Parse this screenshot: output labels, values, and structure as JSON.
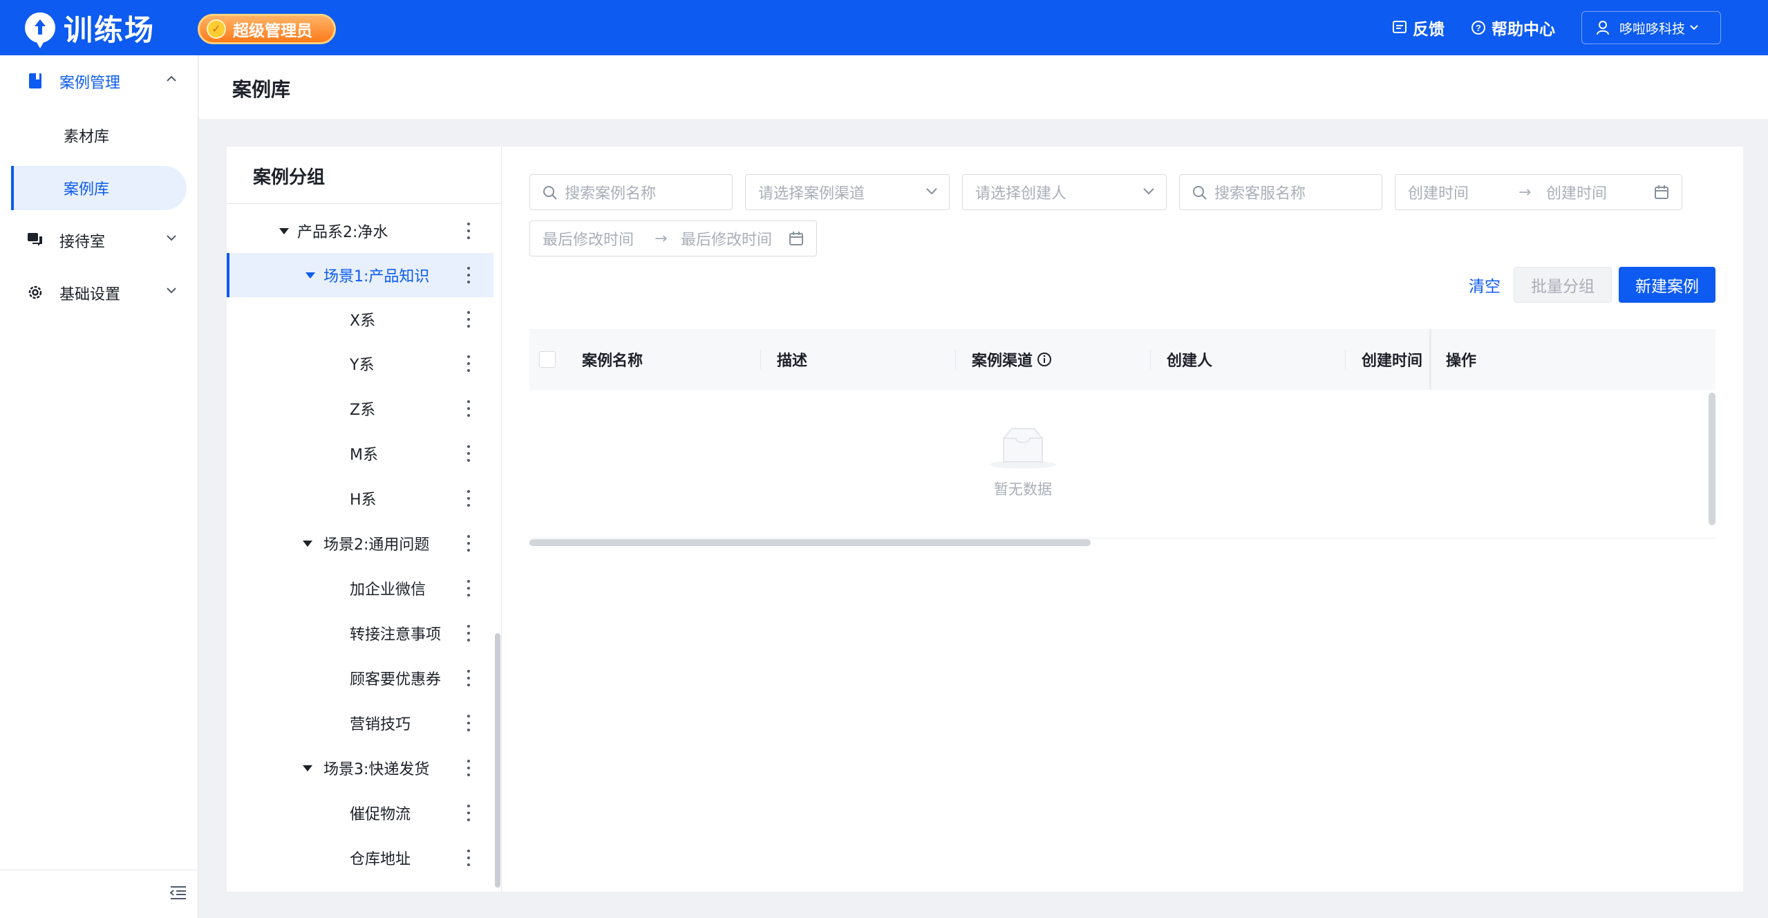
{
  "header": {
    "logo_text": "训练场",
    "role_badge": "超级管理员",
    "feedback_label": "反馈",
    "help_label": "帮助中心",
    "user_name": "哆啦哆科技"
  },
  "sidebar": {
    "items": [
      {
        "label": "案例管理",
        "icon": "book-icon",
        "expanded": true
      },
      {
        "label": "接待室",
        "icon": "chat-icon",
        "expanded": false
      },
      {
        "label": "基础设置",
        "icon": "gear-icon",
        "expanded": false
      }
    ],
    "sub_items": [
      {
        "label": "素材库",
        "active": false
      },
      {
        "label": "案例库",
        "active": true
      }
    ]
  },
  "page": {
    "title": "案例库"
  },
  "tree": {
    "heading": "案例分组",
    "nodes": [
      {
        "label": "产品系2:净水",
        "level": 1,
        "expanded": true,
        "active": false
      },
      {
        "label": "场景1:产品知识",
        "level": 2,
        "expanded": true,
        "active": true
      },
      {
        "label": "X系",
        "level": 3,
        "active": false
      },
      {
        "label": "Y系",
        "level": 3,
        "active": false
      },
      {
        "label": "Z系",
        "level": 3,
        "active": false
      },
      {
        "label": "M系",
        "level": 3,
        "active": false
      },
      {
        "label": "H系",
        "level": 3,
        "active": false
      },
      {
        "label": "场景2:通用问题",
        "level": 2,
        "expanded": true,
        "active": false
      },
      {
        "label": "加企业微信",
        "level": 3,
        "active": false
      },
      {
        "label": "转接注意事项",
        "level": 3,
        "active": false
      },
      {
        "label": "顾客要优惠券",
        "level": 3,
        "active": false
      },
      {
        "label": "营销技巧",
        "level": 3,
        "active": false
      },
      {
        "label": "场景3:快递发货",
        "level": 2,
        "expanded": true,
        "active": false
      },
      {
        "label": "催促物流",
        "level": 3,
        "active": false
      },
      {
        "label": "仓库地址",
        "level": 3,
        "active": false
      }
    ]
  },
  "filters": {
    "case_name_placeholder": "搜索案例名称",
    "channel_placeholder": "请选择案例渠道",
    "creator_placeholder": "请选择创建人",
    "agent_name_placeholder": "搜索客服名称",
    "created_start_placeholder": "创建时间",
    "created_end_placeholder": "创建时间",
    "modified_start_placeholder": "最后修改时间",
    "modified_end_placeholder": "最后修改时间",
    "range_separator": "→"
  },
  "actions": {
    "clear_label": "清空",
    "batch_group_label": "批量分组",
    "new_case_label": "新建案例"
  },
  "table": {
    "columns": [
      "案例名称",
      "描述",
      "案例渠道",
      "创建人",
      "创建时间",
      "操作"
    ],
    "rows": [],
    "empty_text": "暂无数据"
  },
  "colors": {
    "brand": "#0d5bf0",
    "badge": "#ff7a1a",
    "active_bg": "#e8f0fe"
  }
}
